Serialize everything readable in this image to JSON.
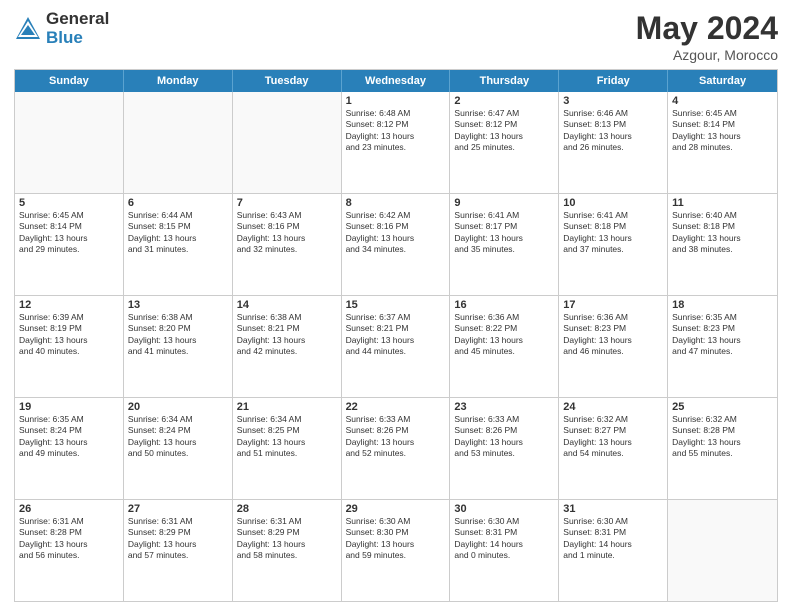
{
  "header": {
    "logo_general": "General",
    "logo_blue": "Blue",
    "month_year": "May 2024",
    "location": "Azgour, Morocco"
  },
  "weekdays": [
    "Sunday",
    "Monday",
    "Tuesday",
    "Wednesday",
    "Thursday",
    "Friday",
    "Saturday"
  ],
  "rows": [
    [
      {
        "day": "",
        "info": ""
      },
      {
        "day": "",
        "info": ""
      },
      {
        "day": "",
        "info": ""
      },
      {
        "day": "1",
        "info": "Sunrise: 6:48 AM\nSunset: 8:12 PM\nDaylight: 13 hours\nand 23 minutes."
      },
      {
        "day": "2",
        "info": "Sunrise: 6:47 AM\nSunset: 8:12 PM\nDaylight: 13 hours\nand 25 minutes."
      },
      {
        "day": "3",
        "info": "Sunrise: 6:46 AM\nSunset: 8:13 PM\nDaylight: 13 hours\nand 26 minutes."
      },
      {
        "day": "4",
        "info": "Sunrise: 6:45 AM\nSunset: 8:14 PM\nDaylight: 13 hours\nand 28 minutes."
      }
    ],
    [
      {
        "day": "5",
        "info": "Sunrise: 6:45 AM\nSunset: 8:14 PM\nDaylight: 13 hours\nand 29 minutes."
      },
      {
        "day": "6",
        "info": "Sunrise: 6:44 AM\nSunset: 8:15 PM\nDaylight: 13 hours\nand 31 minutes."
      },
      {
        "day": "7",
        "info": "Sunrise: 6:43 AM\nSunset: 8:16 PM\nDaylight: 13 hours\nand 32 minutes."
      },
      {
        "day": "8",
        "info": "Sunrise: 6:42 AM\nSunset: 8:16 PM\nDaylight: 13 hours\nand 34 minutes."
      },
      {
        "day": "9",
        "info": "Sunrise: 6:41 AM\nSunset: 8:17 PM\nDaylight: 13 hours\nand 35 minutes."
      },
      {
        "day": "10",
        "info": "Sunrise: 6:41 AM\nSunset: 8:18 PM\nDaylight: 13 hours\nand 37 minutes."
      },
      {
        "day": "11",
        "info": "Sunrise: 6:40 AM\nSunset: 8:18 PM\nDaylight: 13 hours\nand 38 minutes."
      }
    ],
    [
      {
        "day": "12",
        "info": "Sunrise: 6:39 AM\nSunset: 8:19 PM\nDaylight: 13 hours\nand 40 minutes."
      },
      {
        "day": "13",
        "info": "Sunrise: 6:38 AM\nSunset: 8:20 PM\nDaylight: 13 hours\nand 41 minutes."
      },
      {
        "day": "14",
        "info": "Sunrise: 6:38 AM\nSunset: 8:21 PM\nDaylight: 13 hours\nand 42 minutes."
      },
      {
        "day": "15",
        "info": "Sunrise: 6:37 AM\nSunset: 8:21 PM\nDaylight: 13 hours\nand 44 minutes."
      },
      {
        "day": "16",
        "info": "Sunrise: 6:36 AM\nSunset: 8:22 PM\nDaylight: 13 hours\nand 45 minutes."
      },
      {
        "day": "17",
        "info": "Sunrise: 6:36 AM\nSunset: 8:23 PM\nDaylight: 13 hours\nand 46 minutes."
      },
      {
        "day": "18",
        "info": "Sunrise: 6:35 AM\nSunset: 8:23 PM\nDaylight: 13 hours\nand 47 minutes."
      }
    ],
    [
      {
        "day": "19",
        "info": "Sunrise: 6:35 AM\nSunset: 8:24 PM\nDaylight: 13 hours\nand 49 minutes."
      },
      {
        "day": "20",
        "info": "Sunrise: 6:34 AM\nSunset: 8:24 PM\nDaylight: 13 hours\nand 50 minutes."
      },
      {
        "day": "21",
        "info": "Sunrise: 6:34 AM\nSunset: 8:25 PM\nDaylight: 13 hours\nand 51 minutes."
      },
      {
        "day": "22",
        "info": "Sunrise: 6:33 AM\nSunset: 8:26 PM\nDaylight: 13 hours\nand 52 minutes."
      },
      {
        "day": "23",
        "info": "Sunrise: 6:33 AM\nSunset: 8:26 PM\nDaylight: 13 hours\nand 53 minutes."
      },
      {
        "day": "24",
        "info": "Sunrise: 6:32 AM\nSunset: 8:27 PM\nDaylight: 13 hours\nand 54 minutes."
      },
      {
        "day": "25",
        "info": "Sunrise: 6:32 AM\nSunset: 8:28 PM\nDaylight: 13 hours\nand 55 minutes."
      }
    ],
    [
      {
        "day": "26",
        "info": "Sunrise: 6:31 AM\nSunset: 8:28 PM\nDaylight: 13 hours\nand 56 minutes."
      },
      {
        "day": "27",
        "info": "Sunrise: 6:31 AM\nSunset: 8:29 PM\nDaylight: 13 hours\nand 57 minutes."
      },
      {
        "day": "28",
        "info": "Sunrise: 6:31 AM\nSunset: 8:29 PM\nDaylight: 13 hours\nand 58 minutes."
      },
      {
        "day": "29",
        "info": "Sunrise: 6:30 AM\nSunset: 8:30 PM\nDaylight: 13 hours\nand 59 minutes."
      },
      {
        "day": "30",
        "info": "Sunrise: 6:30 AM\nSunset: 8:31 PM\nDaylight: 14 hours\nand 0 minutes."
      },
      {
        "day": "31",
        "info": "Sunrise: 6:30 AM\nSunset: 8:31 PM\nDaylight: 14 hours\nand 1 minute."
      },
      {
        "day": "",
        "info": ""
      }
    ]
  ]
}
